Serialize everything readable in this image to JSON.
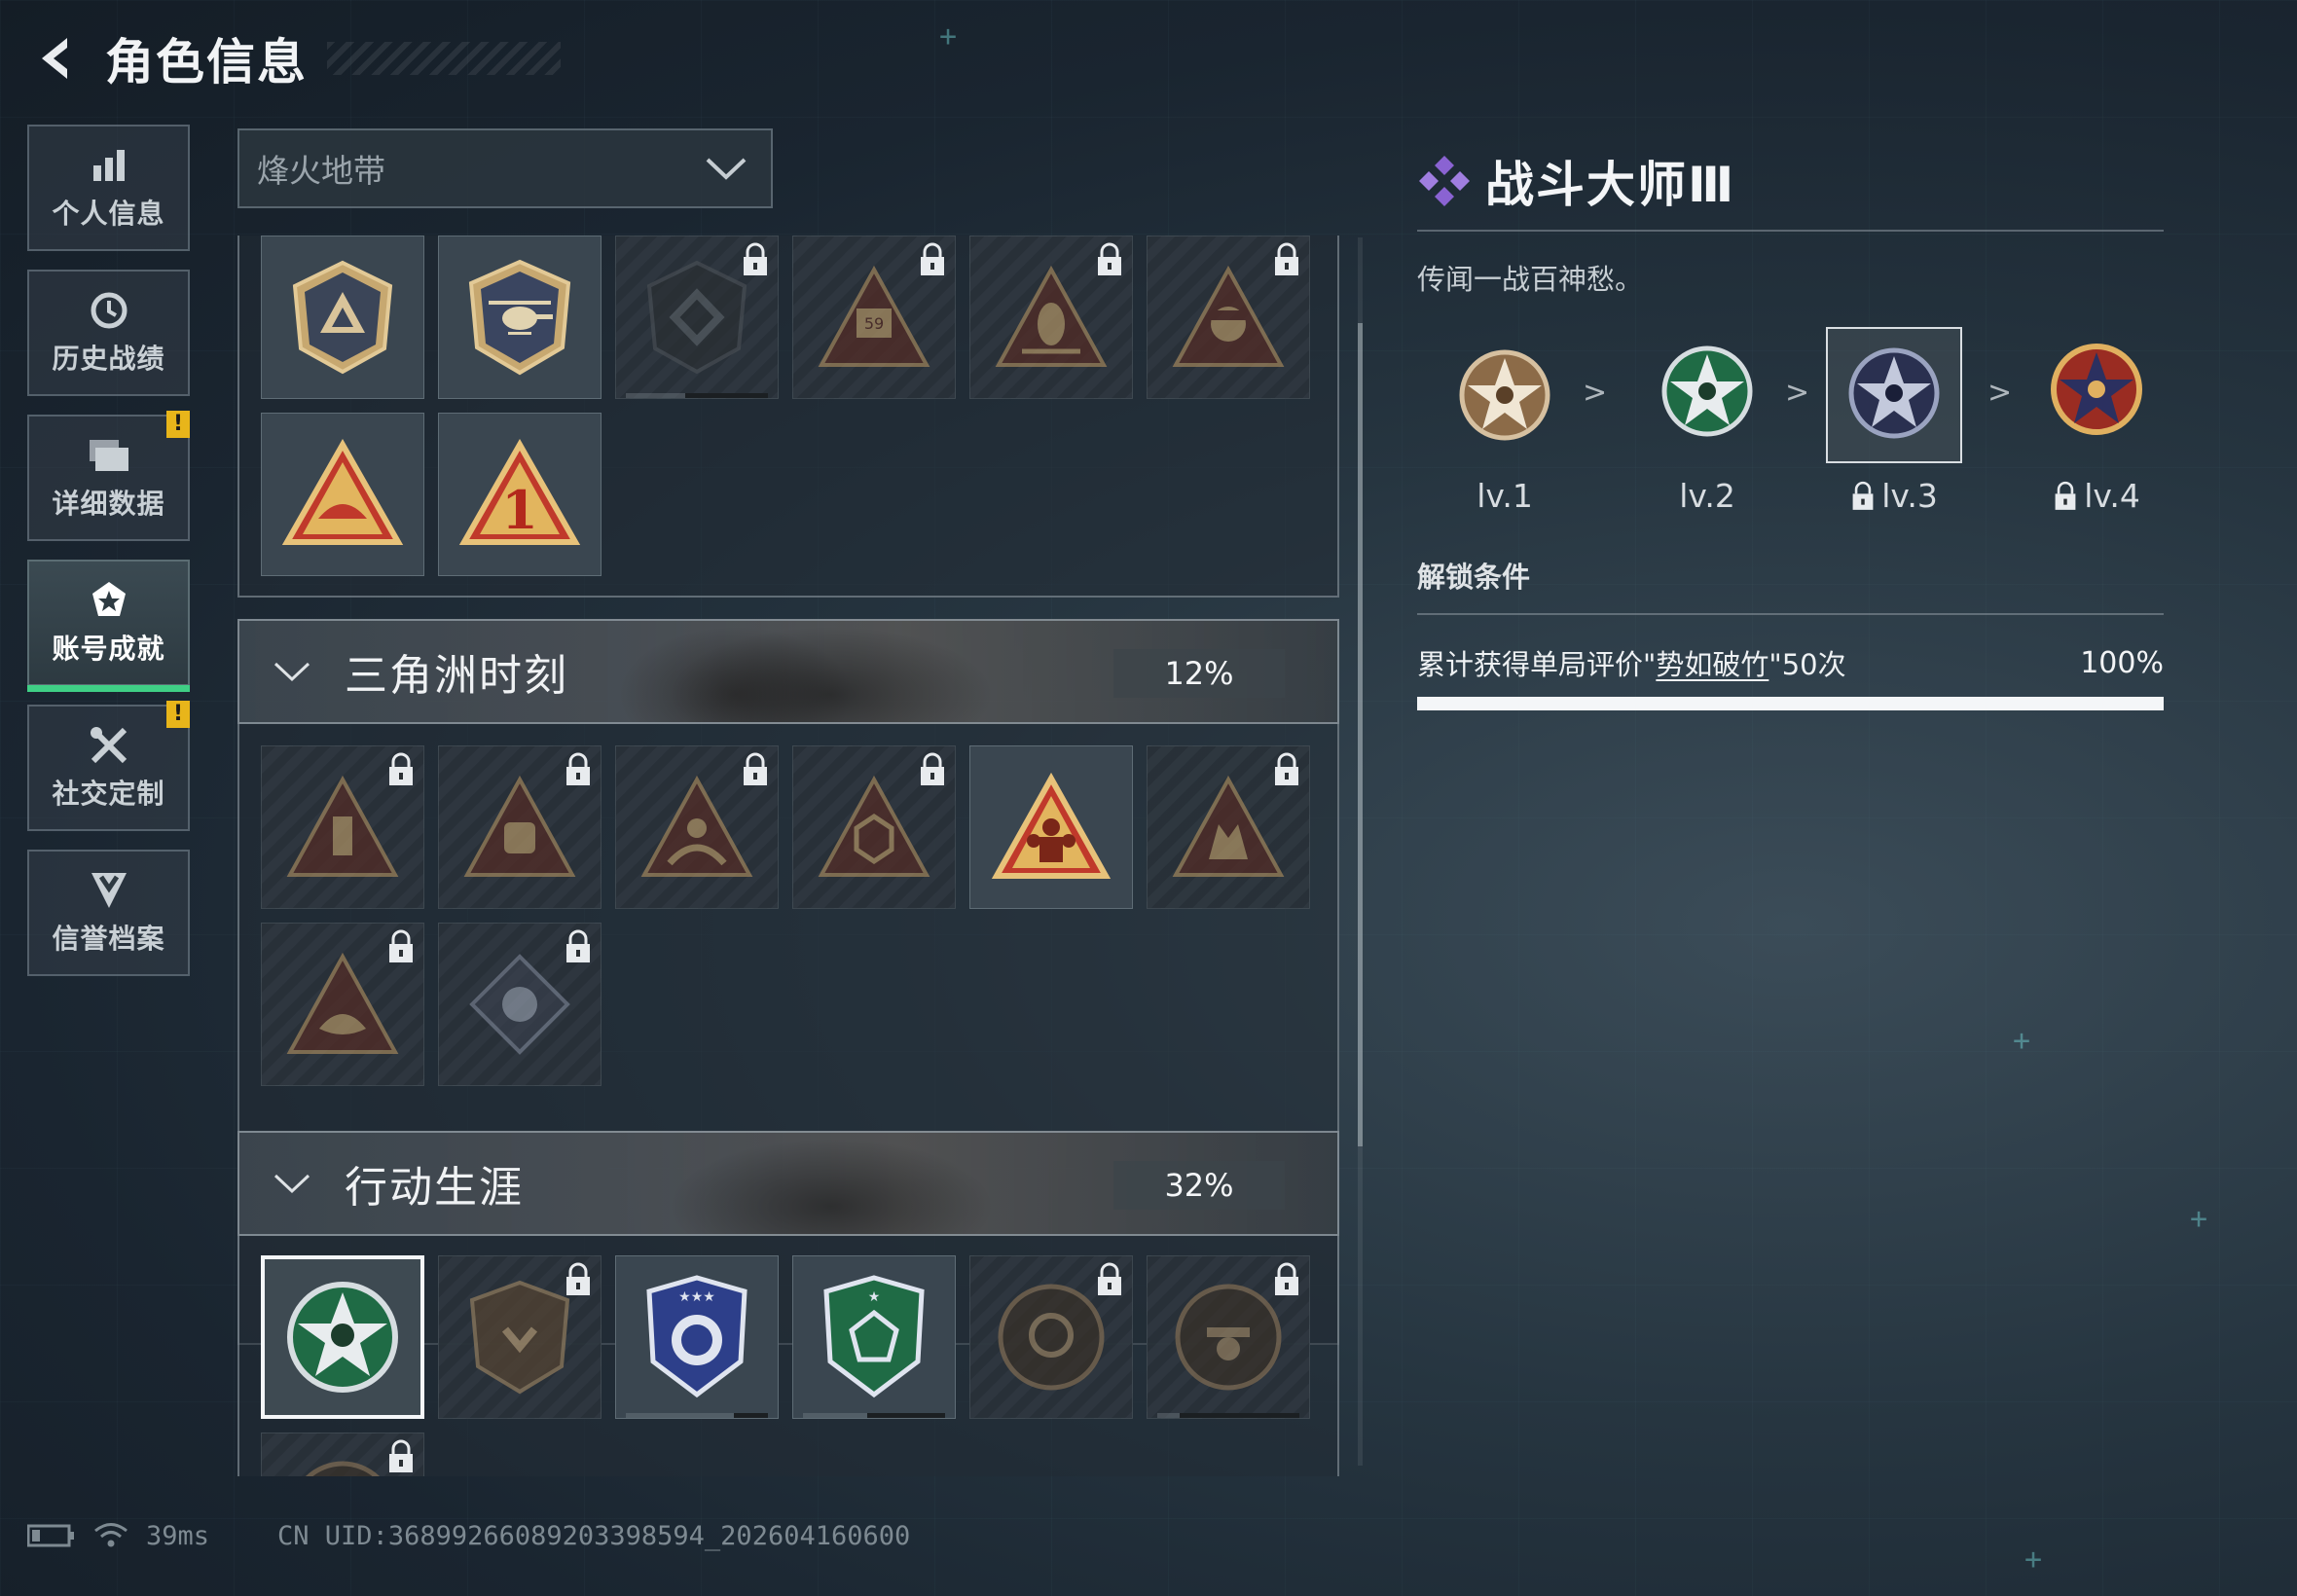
{
  "header": {
    "title": "角色信息"
  },
  "sidebar": {
    "items": [
      {
        "label": "个人信息",
        "icon": "bar-chart-icon",
        "active": false,
        "warning": false
      },
      {
        "label": "历史战绩",
        "icon": "history-icon",
        "active": false,
        "warning": false
      },
      {
        "label": "详细数据",
        "icon": "data-stack-icon",
        "active": false,
        "warning": true,
        "badge": "!"
      },
      {
        "label": "账号成就",
        "icon": "achievement-icon",
        "active": true,
        "warning": false
      },
      {
        "label": "社交定制",
        "icon": "tools-icon",
        "active": false,
        "warning": true,
        "badge": "!"
      },
      {
        "label": "信誉档案",
        "icon": "shield-chevron-icon",
        "active": false,
        "warning": false
      }
    ]
  },
  "mode_select": {
    "value": "烽火地带"
  },
  "sections": [
    {
      "title": "三角洲时刻",
      "progress": "12%"
    },
    {
      "title": "行动生涯",
      "progress": "32%"
    }
  ],
  "detail": {
    "title": "战斗大师Ⅲ",
    "description": "传闻一战百神愁。",
    "levels": [
      {
        "label": "lv.1",
        "locked": false
      },
      {
        "label": "lv.2",
        "locked": false
      },
      {
        "label": "lv.3",
        "locked": true,
        "selected": true
      },
      {
        "label": "lv.4",
        "locked": true
      }
    ],
    "level_separator": ">",
    "condition_title": "解锁条件",
    "condition_prefix": "累计获得单局评价\"",
    "condition_highlight": "势如破竹",
    "condition_suffix": "\"50次",
    "condition_percent": "100%",
    "condition_fraction": 1.0
  },
  "status": {
    "ping": "39ms",
    "uid": "CN UID:36899266089203398594_202604160600"
  },
  "colors": {
    "accent_green": "#3fcf85",
    "warning": "#e8b51a",
    "purple": "#8a63d2"
  }
}
